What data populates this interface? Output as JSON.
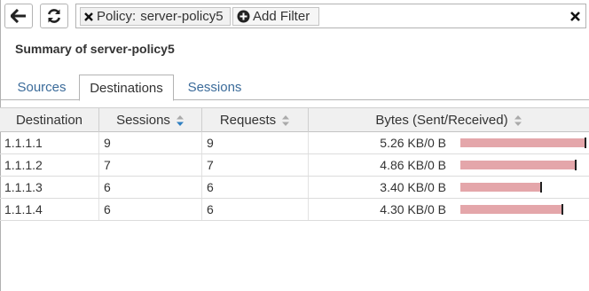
{
  "toolbar": {
    "back_icon": "arrow-left-icon",
    "refresh_icon": "refresh-icon",
    "filters": [
      {
        "key": "Policy:",
        "value": "server-policy5",
        "remove_icon": "close-icon"
      }
    ],
    "add_filter_label": "Add Filter",
    "add_filter_icon": "plus-circle-icon",
    "clear_icon": "close-icon"
  },
  "summary": {
    "title": "Summary of server-policy5"
  },
  "tabs": [
    {
      "label": "Sources",
      "active": false
    },
    {
      "label": "Destinations",
      "active": true
    },
    {
      "label": "Sessions",
      "active": false
    }
  ],
  "table": {
    "columns": {
      "destination": "Destination",
      "sessions": "Sessions",
      "requests": "Requests",
      "bytes": "Bytes (Sent/Received)"
    },
    "sort": {
      "column": "sessions",
      "direction": "descending"
    },
    "rows": [
      {
        "destination": "1.1.1.1",
        "sessions": "9",
        "requests": "9",
        "bytes": "5.26 KB/0 B",
        "bytes_fraction": 1.0
      },
      {
        "destination": "1.1.1.2",
        "sessions": "7",
        "requests": "7",
        "bytes": "4.86 KB/0 B",
        "bytes_fraction": 0.924
      },
      {
        "destination": "1.1.1.3",
        "sessions": "6",
        "requests": "6",
        "bytes": "3.40 KB/0 B",
        "bytes_fraction": 0.646
      },
      {
        "destination": "1.1.1.4",
        "sessions": "6",
        "requests": "6",
        "bytes": "4.30 KB/0 B",
        "bytes_fraction": 0.817
      }
    ]
  },
  "colors": {
    "link": "#3b6b9a",
    "bar": "#e4a6aa",
    "sort_active": "#2f7fc1",
    "sort_inactive": "#aaaaaa"
  }
}
